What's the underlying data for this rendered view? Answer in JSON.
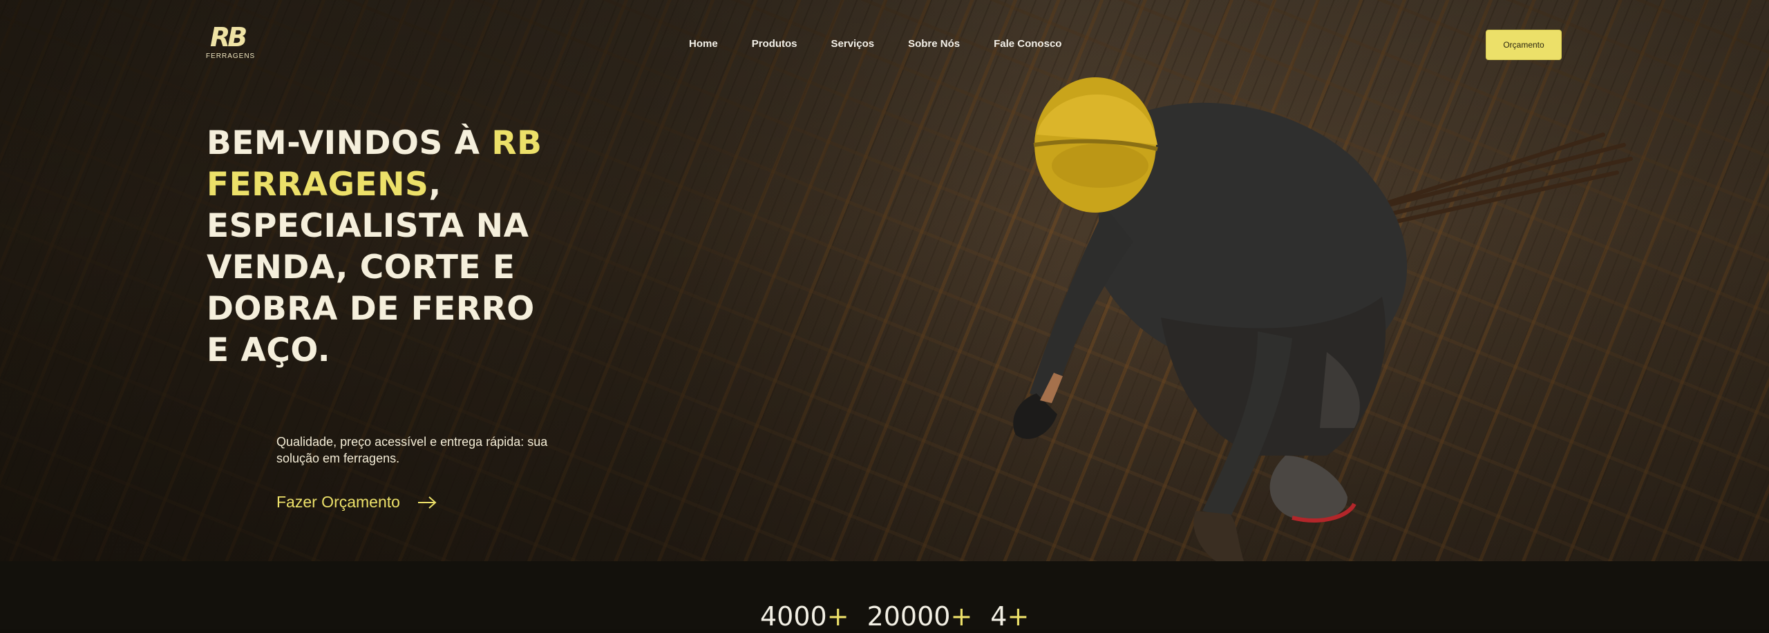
{
  "brand": {
    "logo_mark": "RB",
    "logo_sub": "FERRAGENS"
  },
  "nav": {
    "items": [
      "Home",
      "Produtos",
      "Serviços",
      "Sobre Nós",
      "Fale Conosco"
    ],
    "cta_label": "Orçamento"
  },
  "hero": {
    "title_prefix": "BEM-VINDOS À ",
    "title_highlight": "RB FERRAGENS",
    "title_suffix": ", ESPECIALISTA NA VENDA, CORTE E DOBRA DE FERRO E AÇO.",
    "subtitle": "Qualidade, preço acessível e entrega rápida: sua solução em ferragens.",
    "cta_label": "Fazer Orçamento"
  },
  "stats": [
    {
      "value": "4000",
      "suffix": "+"
    },
    {
      "value": "20000",
      "suffix": "+"
    },
    {
      "value": "4",
      "suffix": "+"
    }
  ],
  "colors": {
    "accent": "#ece069",
    "dark_band": "#13110c",
    "text_light": "#f5efdc"
  },
  "icons": {
    "cta_arrow": "arrow-right-icon"
  }
}
